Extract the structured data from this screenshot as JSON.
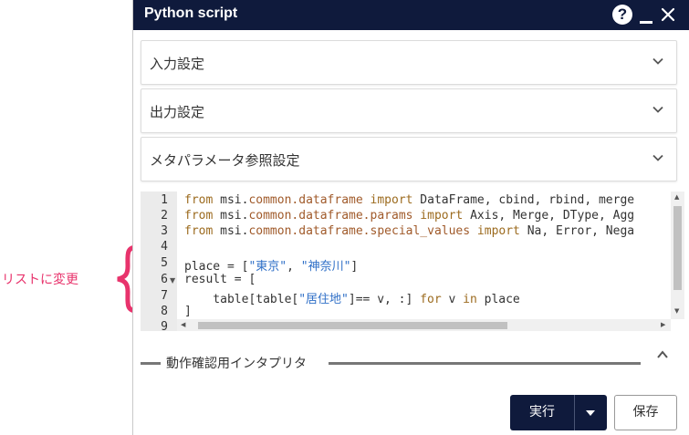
{
  "annotation": {
    "text": "リストに変更",
    "color": "#e8336c"
  },
  "window": {
    "title": "Python script",
    "help_symbol": "?",
    "titlebar_color": "#0f1a3c"
  },
  "sections": [
    {
      "label": "入力設定"
    },
    {
      "label": "出力設定"
    },
    {
      "label": "メタパラメータ参照設定"
    }
  ],
  "editor": {
    "line_numbers": [
      "1",
      "2",
      "3",
      "4",
      "5",
      "6",
      "7",
      "8",
      "9"
    ],
    "lines": {
      "l1": {
        "a": "from",
        "b": " msi.",
        "c": "common.dataframe",
        "d": " import",
        "e": " DataFrame, cbind, rbind, merge"
      },
      "l2": {
        "a": "from",
        "b": " msi.",
        "c": "common.dataframe.params",
        "d": " import",
        "e": " Axis, Merge, DType, Agg"
      },
      "l3": {
        "a": "from",
        "b": " msi.",
        "c": "common.dataframe.special_values",
        "d": " import",
        "e": " Na, Error, Nega"
      },
      "l5": {
        "a": "place = [",
        "b": "\"東京\"",
        "c": ", ",
        "d": "\"神奈川\"",
        "e": "]"
      },
      "l6": {
        "a": "result = ["
      },
      "l7": {
        "a": "    table[table[",
        "b": "\"居住地\"",
        "c": "]== v, :] ",
        "d": "for",
        "e": " v ",
        "f": "in",
        "g": " place"
      },
      "l8": {
        "a": "]"
      }
    }
  },
  "interpreter": {
    "label": "動作確認用インタプリタ"
  },
  "buttons": {
    "run_label": "実行",
    "save_label": "保存"
  }
}
